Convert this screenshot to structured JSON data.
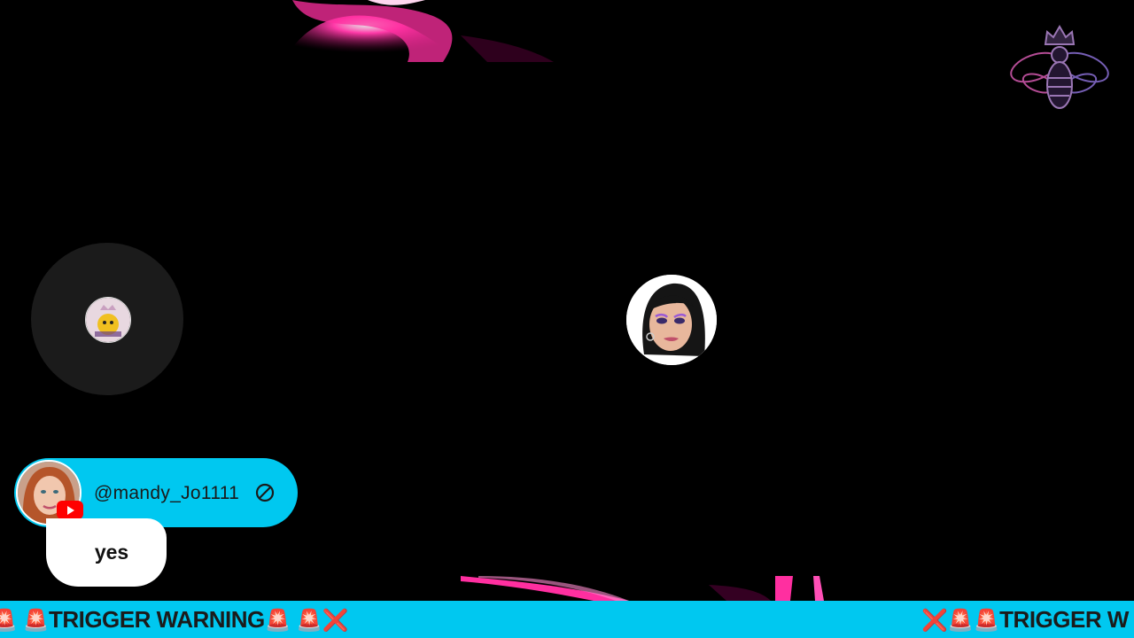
{
  "commenter": {
    "handle": "@mandy_Jo1111",
    "message": "yes",
    "platform": "youtube",
    "badge_icon": "youtube-icon",
    "action_icon": "blocked-icon"
  },
  "ticker": {
    "segment_a_prefix": "🚨 🚨",
    "segment_a_text": "TRIGGER WARNING",
    "segment_a_suffix": "🚨 🚨❌",
    "segment_b_prefix": "❌🚨🚨",
    "segment_b_text": "TRIGGER W"
  },
  "colors": {
    "accent": "#00c8f0",
    "swirl": "#ff2fa0",
    "background": "#000000"
  }
}
